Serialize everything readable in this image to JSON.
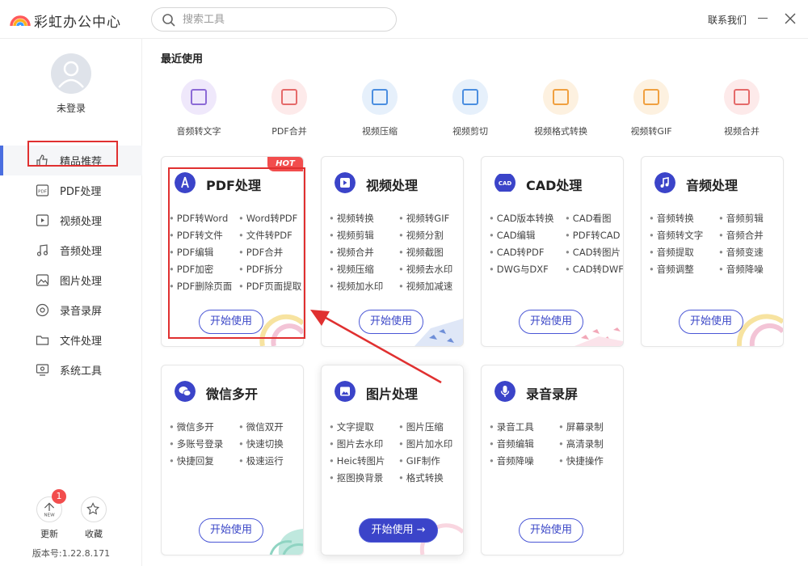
{
  "app": {
    "title": "彩虹办公中心",
    "contact": "联系我们"
  },
  "search": {
    "placeholder": "搜索工具"
  },
  "user": {
    "status": "未登录"
  },
  "sidebar": {
    "items": [
      {
        "label": "精品推荐",
        "icon": "thumbs-up-icon",
        "active": true
      },
      {
        "label": "PDF处理",
        "icon": "pdf-icon"
      },
      {
        "label": "视频处理",
        "icon": "video-icon"
      },
      {
        "label": "音频处理",
        "icon": "music-icon"
      },
      {
        "label": "图片处理",
        "icon": "image-icon"
      },
      {
        "label": "录音录屏",
        "icon": "record-icon"
      },
      {
        "label": "文件处理",
        "icon": "folder-icon"
      },
      {
        "label": "系统工具",
        "icon": "monitor-icon"
      }
    ],
    "update": {
      "label": "更新",
      "badge": "1",
      "icon_text": "NEW"
    },
    "favorite": {
      "label": "收藏"
    },
    "version": "版本号:1.22.8.171"
  },
  "recent": {
    "title": "最近使用",
    "items": [
      {
        "label": "音频转文字",
        "bg": "#efe8fb",
        "color": "#8c6ad6"
      },
      {
        "label": "PDF合并",
        "bg": "#fdeaea",
        "color": "#e56a6a"
      },
      {
        "label": "视频压缩",
        "bg": "#e6f0fb",
        "color": "#4b8ee0"
      },
      {
        "label": "视频剪切",
        "bg": "#e6f0fb",
        "color": "#4b8ee0"
      },
      {
        "label": "视频格式转换",
        "bg": "#fdf1e0",
        "color": "#f0a040"
      },
      {
        "label": "视频转GIF",
        "bg": "#fdf1e0",
        "color": "#f0a040"
      },
      {
        "label": "视频合并",
        "bg": "#fdeaea",
        "color": "#e56a6a"
      }
    ]
  },
  "cards": [
    {
      "title": "PDF处理",
      "hot": "HOT",
      "color": "#3b44c9",
      "btn": "开始使用",
      "features": [
        "PDF转Word",
        "Word转PDF",
        "PDF转文件",
        "文件转PDF",
        "PDF编辑",
        "PDF合并",
        "PDF加密",
        "PDF拆分",
        "PDF删除页面",
        "PDF页面提取"
      ]
    },
    {
      "title": "视频处理",
      "color": "#3b44c9",
      "btn": "开始使用",
      "features": [
        "视频转换",
        "视频转GIF",
        "视频剪辑",
        "视频分割",
        "视频合并",
        "视频截图",
        "视频压缩",
        "视频去水印",
        "视频加水印",
        "视频加减速"
      ]
    },
    {
      "title": "CAD处理",
      "color": "#3b44c9",
      "icon_text": "CAD",
      "btn": "开始使用",
      "features": [
        "CAD版本转换",
        "CAD看图",
        "CAD编辑",
        "PDF转CAD",
        "CAD转PDF",
        "CAD转图片",
        "DWG与DXF",
        "CAD转DWF"
      ]
    },
    {
      "title": "音频处理",
      "color": "#3b44c9",
      "btn": "开始使用",
      "features": [
        "音频转换",
        "音频剪辑",
        "音频转文字",
        "音频合并",
        "音频提取",
        "音频变速",
        "音频调整",
        "音频降噪"
      ]
    },
    {
      "title": "微信多开",
      "color": "#3b44c9",
      "btn": "开始使用",
      "features": [
        "微信多开",
        "微信双开",
        "多账号登录",
        "快速切换",
        "快捷回复",
        "极速运行"
      ]
    },
    {
      "title": "图片处理",
      "color": "#3b44c9",
      "btn": "开始使用 →",
      "features": [
        "文字提取",
        "图片压缩",
        "图片去水印",
        "图片加水印",
        "Heic转图片",
        "GIF制作",
        "抠图换背景",
        "格式转换"
      ]
    },
    {
      "title": "录音录屏",
      "color": "#3b44c9",
      "btn": "开始使用",
      "features": [
        "录音工具",
        "屏幕录制",
        "音频编辑",
        "高清录制",
        "音频降噪",
        "快捷操作"
      ]
    }
  ],
  "colors": {
    "accent": "#3b44c9",
    "hot": "#f24d4d",
    "highlight": "#e03030"
  }
}
